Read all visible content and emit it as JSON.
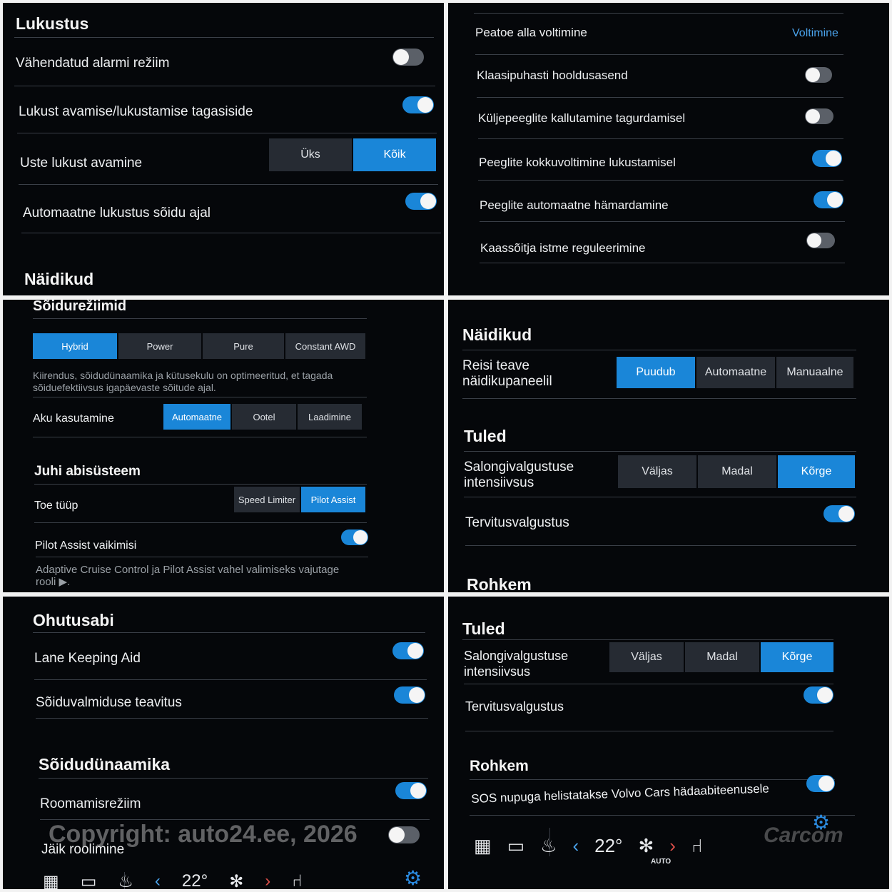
{
  "p1": {
    "title": "Lukustus",
    "row1": "Vähendatud alarmi režiim",
    "row2": "Lukust avamise/lukustamise tagasiside",
    "row3": "Uste lukust avamine",
    "row3_opt1": "Üks",
    "row3_opt2": "Kõik",
    "row4": "Automaatne lukustus sõidu ajal",
    "footer": "Näidikud"
  },
  "p2": {
    "row1": "Peatoe alla voltimine",
    "row1_value": "Voltimine",
    "row2": "Klaasipuhasti hooldusasend",
    "row3": "Küljepeeglite kallutamine tagurdamisel",
    "row4": "Peeglite kokkuvoltimine lukustamisel",
    "row5": "Peeglite automaatne hämardamine",
    "row6": "Kaassõitja istme reguleerimine"
  },
  "p3": {
    "title": "Sõidurežiimid",
    "modes": [
      "Hybrid",
      "Power",
      "Pure",
      "Constant AWD"
    ],
    "modes_desc": "Kiirendus, sõidudünaamika ja kütusekulu on optimeeritud, et tagada sõiduefektiivsus igapäevaste sõitude ajal.",
    "battery_label": "Aku kasutamine",
    "battery_opts": [
      "Automaatne",
      "Ootel",
      "Laadimine"
    ],
    "assist_title": "Juhi abisüsteem",
    "support_label": "Toe tüüp",
    "support_opts": [
      "Speed Limiter",
      "Pilot Assist"
    ],
    "pilot_label": "Pilot Assist vaikimisi",
    "pilot_desc": "Adaptive Cruise Control ja Pilot Assist vahel valimiseks vajutage rooli ▶."
  },
  "p4": {
    "title": "Näidikud",
    "trip_label": "Reisi teave näidikupaneelil",
    "trip_opts": [
      "Puudub",
      "Automaatne",
      "Manuaalne"
    ],
    "lights_title": "Tuled",
    "interior_label": "Salongivalgustuse intensiivsus",
    "interior_opts": [
      "Väljas",
      "Madal",
      "Kõrge"
    ],
    "welcome_label": "Tervitusvalgustus",
    "more_title": "Rohkem"
  },
  "p5": {
    "title": "Ohutusabi",
    "row1": "Lane Keeping Aid",
    "row2": "Sõiduvalmiduse teavitus",
    "dyn_title": "Sõidudünaamika",
    "row3": "Roomamisrežiim",
    "row4": "Jäik roolimine",
    "watermark": "Copyright: auto24.ee, 2026",
    "temp": "22°"
  },
  "p6": {
    "lights_title": "Tuled",
    "interior_label": "Salongivalgustuse intensiivsus",
    "interior_opts": [
      "Väljas",
      "Madal",
      "Kõrge"
    ],
    "welcome_label": "Tervitusvalgustus",
    "more_title": "Rohkem",
    "sos_label": "SOS nupuga helistatakse Volvo Cars hädaabiteenusele",
    "temp": "22°",
    "auto": "AUTO",
    "brand": "Carcom"
  },
  "colors": {
    "accent": "#1a86d8",
    "background": "#05070a",
    "segment": "#262b33"
  },
  "icons": [
    "grid-icon",
    "camera-icon",
    "seat-heat-icon",
    "chevron-left-icon",
    "fan-icon",
    "chevron-right-icon",
    "seat-icon",
    "gear-icon"
  ]
}
